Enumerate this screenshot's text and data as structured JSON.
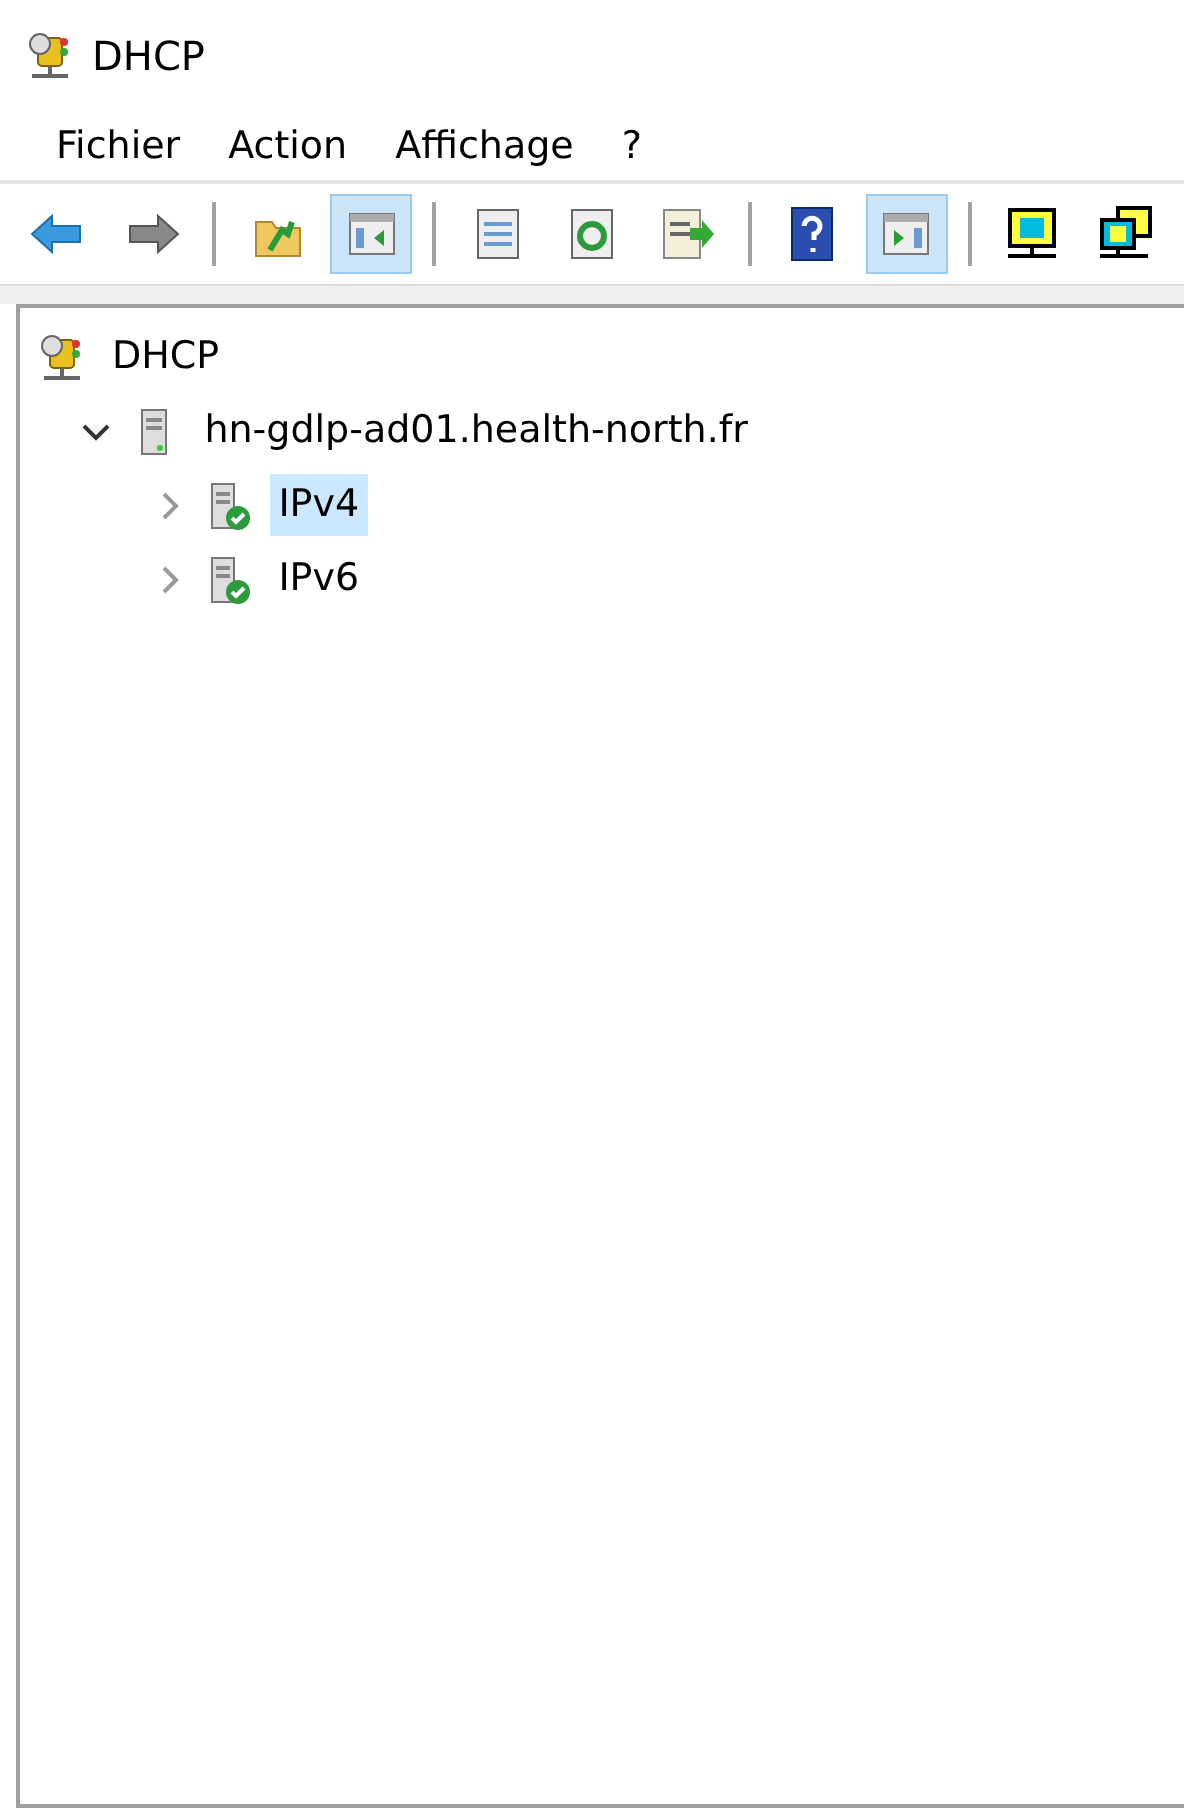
{
  "window": {
    "title": "DHCP"
  },
  "menu": [
    "Fichier",
    "Action",
    "Affichage",
    "?"
  ],
  "toolbar": [
    {
      "kind": "back",
      "pressed": false
    },
    {
      "kind": "forward",
      "pressed": false
    },
    {
      "kind": "separator"
    },
    {
      "kind": "up",
      "pressed": false
    },
    {
      "kind": "tree",
      "pressed": true
    },
    {
      "kind": "separator"
    },
    {
      "kind": "properties",
      "pressed": false
    },
    {
      "kind": "refresh",
      "pressed": false
    },
    {
      "kind": "export",
      "pressed": false
    },
    {
      "kind": "separator"
    },
    {
      "kind": "help",
      "pressed": false
    },
    {
      "kind": "actionpane",
      "pressed": true
    },
    {
      "kind": "separator"
    },
    {
      "kind": "monitor",
      "pressed": false
    },
    {
      "kind": "monitors",
      "pressed": false
    }
  ],
  "tree": [
    {
      "label": "DHCP",
      "kind": "dhcp",
      "selected": false,
      "children": [
        {
          "label": "hn-gdlp-ad01.health-north.fr",
          "kind": "server",
          "expanded": true,
          "selected": false,
          "children": [
            {
              "label": "IPv4",
              "kind": "scope",
              "expanded": false,
              "selected": true
            },
            {
              "label": "IPv6",
              "kind": "scope",
              "expanded": false,
              "selected": false
            }
          ]
        }
      ]
    }
  ]
}
